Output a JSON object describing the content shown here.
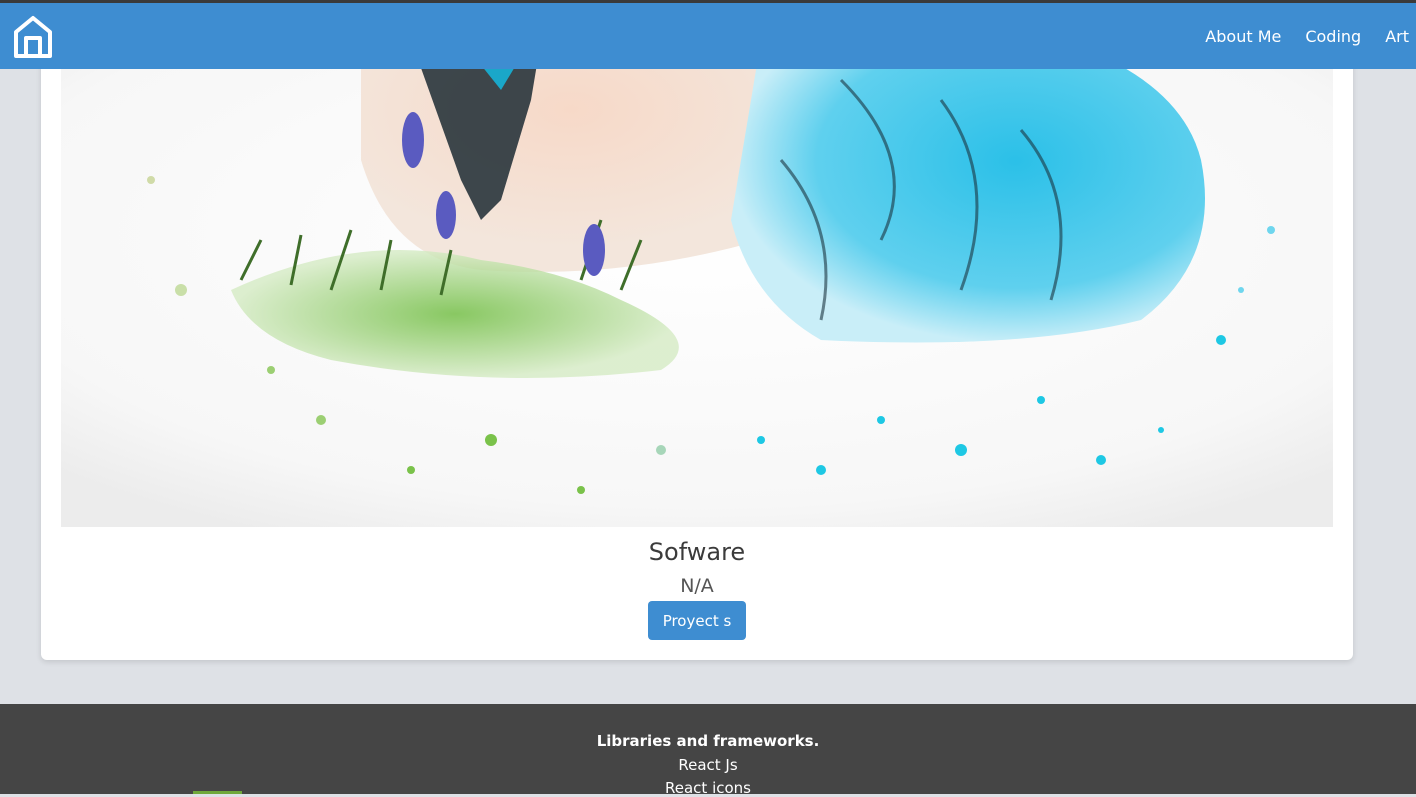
{
  "nav": {
    "home_icon": "home-icon",
    "links": [
      "About Me",
      "Coding",
      "Art"
    ]
  },
  "card": {
    "image": "watercolor-illustration",
    "title": "Sofware",
    "subtitle": "N/A",
    "button_label": "Proyect s"
  },
  "footer": {
    "title": "Libraries and frameworks.",
    "items": [
      "React Js",
      "React icons"
    ]
  },
  "colors": {
    "navbar": "#3e8dd1",
    "button": "#3e8dd1",
    "page_bg": "#dee1e6",
    "footer_bg": "#454545"
  }
}
